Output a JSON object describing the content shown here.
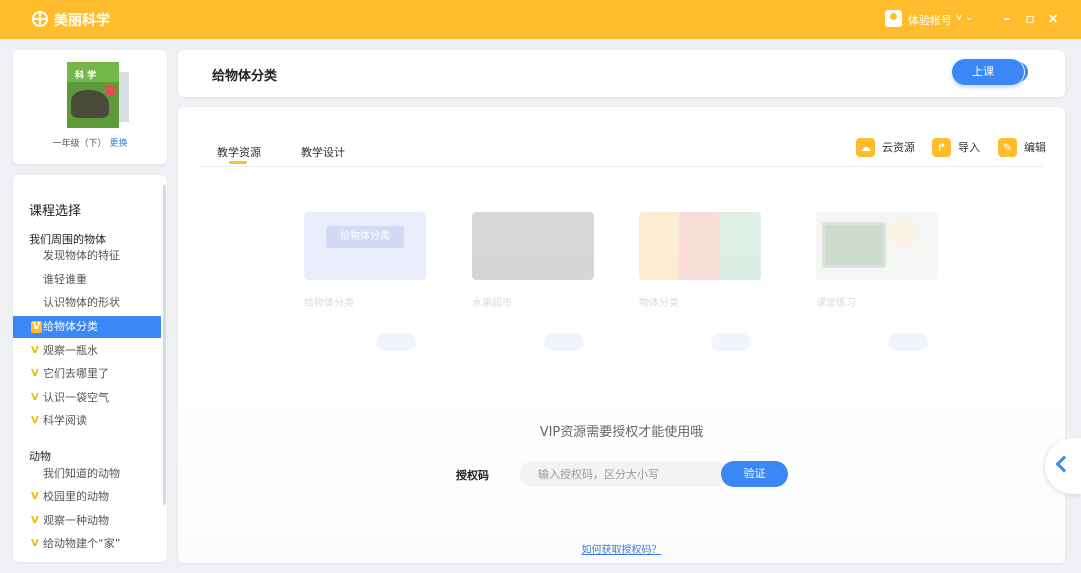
{
  "app": {
    "name": "美丽科学",
    "user_name": "体验帐号",
    "user_badge": "v ⌄"
  },
  "window": {
    "minimize": "–",
    "maximize": "▫",
    "close": "×"
  },
  "book": {
    "cover_title": "科 学",
    "grade": "一年级（下）",
    "change_label": "更换"
  },
  "lessons": {
    "heading": "课程选择",
    "units": [
      {
        "title": "我们周围的物体"
      },
      {
        "title": "动物"
      }
    ],
    "items": [
      {
        "label": "发现物体的特征",
        "vip": false,
        "active": false
      },
      {
        "label": "谁轻谁重",
        "vip": false,
        "active": false
      },
      {
        "label": "认识物体的形状",
        "vip": false,
        "active": false
      },
      {
        "label": "给物体分类",
        "vip": true,
        "active": true
      },
      {
        "label": "观察一瓶水",
        "vip": true,
        "active": false
      },
      {
        "label": "它们去哪里了",
        "vip": true,
        "active": false
      },
      {
        "label": "认识一袋空气",
        "vip": true,
        "active": false
      },
      {
        "label": "科学阅读",
        "vip": true,
        "active": false
      },
      {
        "label": "我们知道的动物",
        "vip": false,
        "active": false
      },
      {
        "label": "校园里的动物",
        "vip": true,
        "active": false
      },
      {
        "label": "观察一种动物",
        "vip": true,
        "active": false
      },
      {
        "label": "给动物建个“家”",
        "vip": true,
        "active": false
      }
    ]
  },
  "header": {
    "title": "给物体分类",
    "start_class": "上课"
  },
  "tabs": [
    {
      "label": "教学资源"
    },
    {
      "label": "教学设计"
    }
  ],
  "tools": [
    {
      "label": "云资源",
      "icon": "cloud-icon"
    },
    {
      "label": "导入",
      "icon": "import-icon"
    },
    {
      "label": "编辑",
      "icon": "edit-icon"
    }
  ],
  "resources": [
    {
      "title": "给物体分类",
      "thumb_color": "#b9c5f0",
      "thumb_label": "给物体分类"
    },
    {
      "title": "水果超市",
      "thumb_color": "#7a7a7a",
      "thumb_label": ""
    },
    {
      "title": "物体分类",
      "thumb_color": "#f3c36a",
      "thumb_label": ""
    },
    {
      "title": "课堂练习",
      "thumb_color": "#d9e3d9",
      "thumb_label": ""
    }
  ],
  "vip": {
    "message": "VIP资源需要授权才能使用哦",
    "code_label": "授权码",
    "code_placeholder": "输入授权码，区分大小写",
    "verify_label": "验证",
    "help_link": "如何获取授权码？"
  },
  "colors": {
    "accent": "#ffbd2e",
    "primary": "#3a87f5"
  }
}
